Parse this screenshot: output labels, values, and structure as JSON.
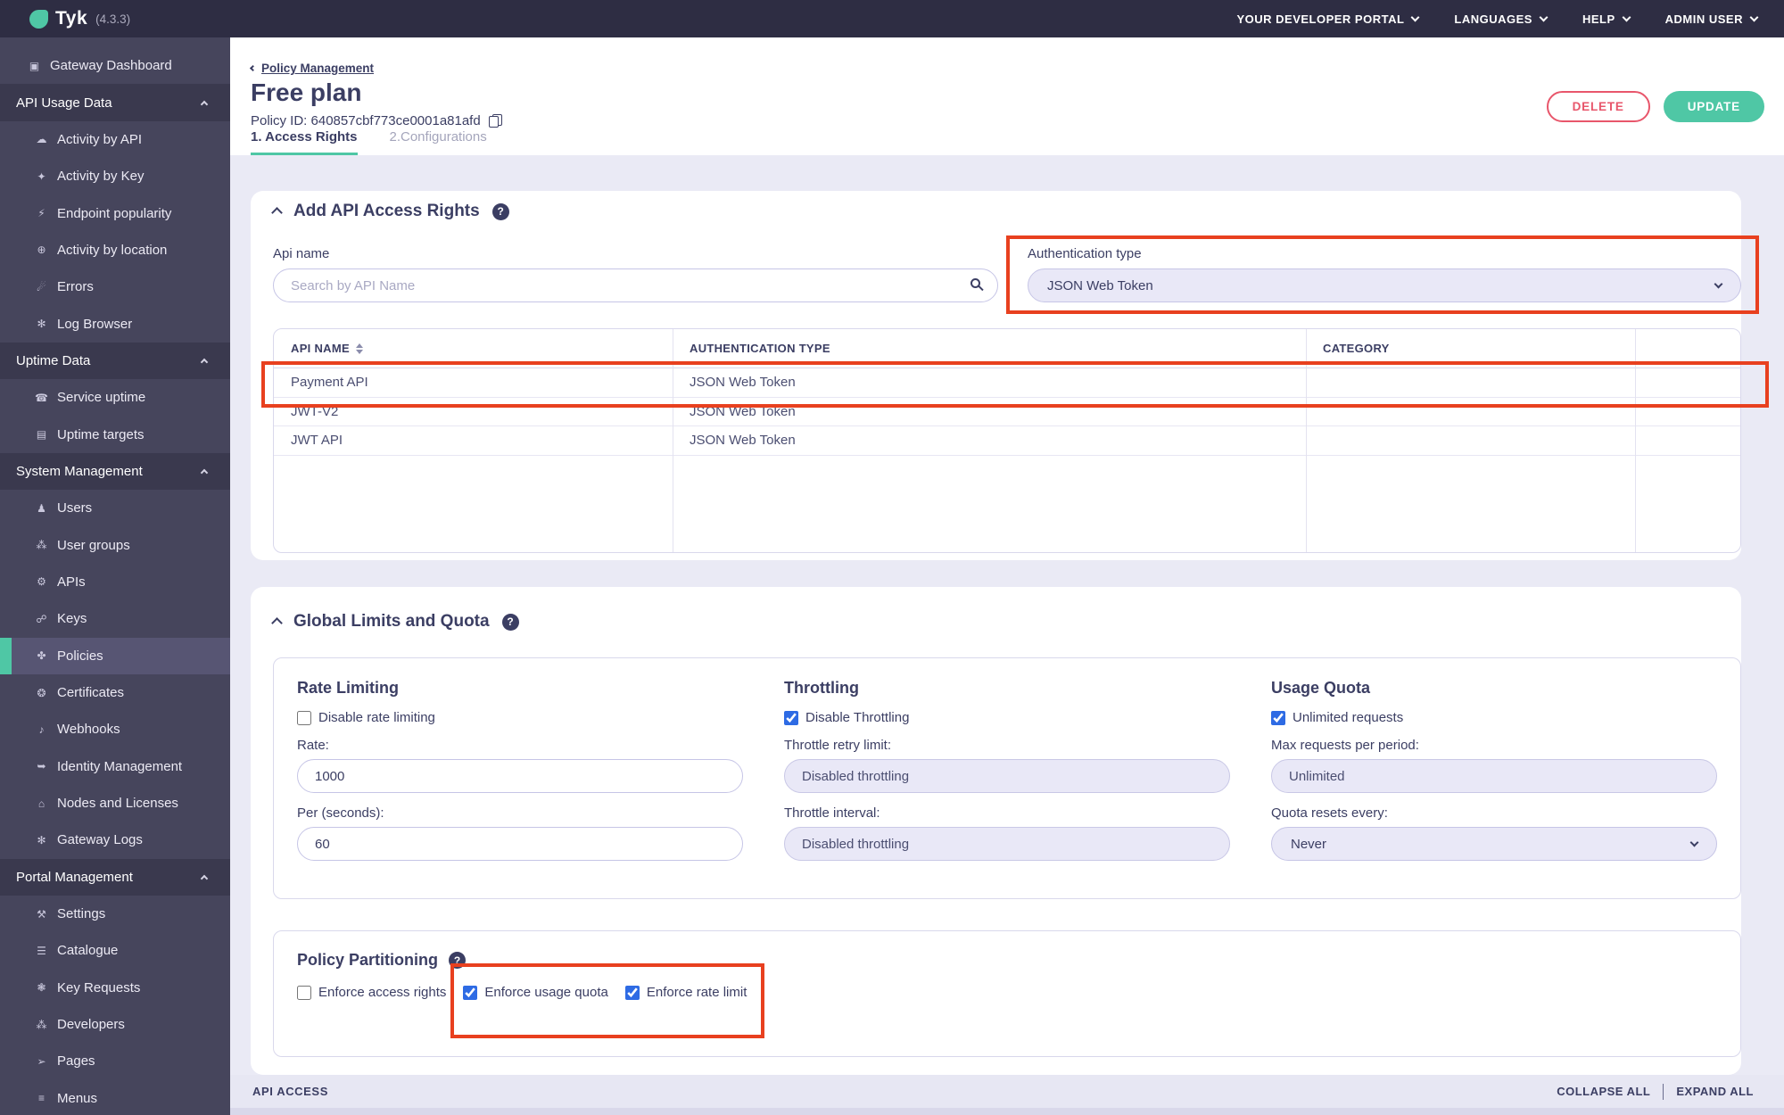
{
  "header": {
    "brand": "Tyk",
    "version": "(4.3.3)",
    "menu": [
      {
        "label": "YOUR DEVELOPER PORTAL"
      },
      {
        "label": "LANGUAGES"
      },
      {
        "label": "HELP"
      },
      {
        "label": "ADMIN USER"
      }
    ]
  },
  "sidebar": {
    "items": [
      {
        "type": "item",
        "top": true,
        "icon": "monitor",
        "glyph": "▣",
        "label": "Gateway Dashboard"
      },
      {
        "type": "section",
        "label": "API Usage Data"
      },
      {
        "type": "item",
        "icon": "cloud",
        "glyph": "☁",
        "label": "Activity by API"
      },
      {
        "type": "item",
        "icon": "key",
        "glyph": "✦",
        "label": "Activity by Key"
      },
      {
        "type": "item",
        "icon": "endpoint",
        "glyph": "⚡",
        "label": "Endpoint popularity"
      },
      {
        "type": "item",
        "icon": "globe",
        "glyph": "⊕",
        "label": "Activity by location"
      },
      {
        "type": "item",
        "icon": "bomb",
        "glyph": "☄",
        "label": "Errors"
      },
      {
        "type": "item",
        "icon": "bug",
        "glyph": "✻",
        "label": "Log Browser"
      },
      {
        "type": "section",
        "label": "Uptime Data"
      },
      {
        "type": "item",
        "icon": "phone",
        "glyph": "☎",
        "label": "Service uptime"
      },
      {
        "type": "item",
        "icon": "list",
        "glyph": "▤",
        "label": "Uptime targets"
      },
      {
        "type": "section",
        "label": "System Management"
      },
      {
        "type": "item",
        "icon": "user",
        "glyph": "♟",
        "label": "Users"
      },
      {
        "type": "item",
        "icon": "user-group",
        "glyph": "⁂",
        "label": "User groups"
      },
      {
        "type": "item",
        "icon": "gear",
        "glyph": "⚙",
        "label": "APIs"
      },
      {
        "type": "item",
        "icon": "network",
        "glyph": "☍",
        "label": "Keys"
      },
      {
        "type": "item",
        "icon": "badge",
        "glyph": "✤",
        "label": "Policies",
        "selected": true
      },
      {
        "type": "item",
        "icon": "certificate",
        "glyph": "❂",
        "label": "Certificates"
      },
      {
        "type": "item",
        "icon": "bell",
        "glyph": "♪",
        "label": "Webhooks"
      },
      {
        "type": "item",
        "icon": "identity",
        "glyph": "➥",
        "label": "Identity Management"
      },
      {
        "type": "item",
        "icon": "bank",
        "glyph": "⌂",
        "label": "Nodes and Licenses"
      },
      {
        "type": "item",
        "icon": "bug",
        "glyph": "✻",
        "label": "Gateway Logs"
      },
      {
        "type": "section",
        "label": "Portal Management"
      },
      {
        "type": "item",
        "icon": "wrench",
        "glyph": "⚒",
        "label": "Settings"
      },
      {
        "type": "item",
        "icon": "catalogue",
        "glyph": "☰",
        "label": "Catalogue"
      },
      {
        "type": "item",
        "icon": "paw",
        "glyph": "❃",
        "label": "Key Requests"
      },
      {
        "type": "item",
        "icon": "developers",
        "glyph": "⁂",
        "label": "Developers"
      },
      {
        "type": "item",
        "icon": "pages",
        "glyph": "➢",
        "label": "Pages"
      },
      {
        "type": "item",
        "icon": "menu",
        "glyph": "≡",
        "label": "Menus"
      }
    ]
  },
  "page": {
    "breadcrumb": "Policy Management",
    "title": "Free plan",
    "policy_id": "Policy ID: 640857cbf773ce0001a81afd",
    "tabs": [
      {
        "label": "1. Access Rights",
        "active": true
      },
      {
        "label": "2.Configurations",
        "active": false
      }
    ],
    "delete_label": "DELETE",
    "update_label": "UPDATE"
  },
  "access_rights": {
    "heading": "Add API Access Rights",
    "api_name_label": "Api name",
    "search_placeholder": "Search by API Name",
    "auth_label": "Authentication type",
    "auth_value": "JSON Web Token",
    "table": {
      "columns": [
        "API NAME",
        "AUTHENTICATION TYPE",
        "CATEGORY"
      ],
      "rows": [
        [
          "Payment API",
          "JSON Web Token",
          ""
        ],
        [
          "JWT-V2",
          "JSON Web Token",
          ""
        ],
        [
          "JWT API",
          "JSON Web Token",
          ""
        ]
      ]
    }
  },
  "limits": {
    "heading": "Global Limits and Quota",
    "rate": {
      "title": "Rate Limiting",
      "checkbox": "Disable rate limiting",
      "checked": false,
      "rate_label": "Rate:",
      "rate_value": "1000",
      "per_label": "Per (seconds):",
      "per_value": "60"
    },
    "throttle": {
      "title": "Throttling",
      "checkbox": "Disable Throttling",
      "checked": true,
      "retry_label": "Throttle retry limit:",
      "retry_value": "Disabled throttling",
      "interval_label": "Throttle interval:",
      "interval_value": "Disabled throttling"
    },
    "quota": {
      "title": "Usage Quota",
      "checkbox": "Unlimited requests",
      "checked": true,
      "max_label": "Max requests per period:",
      "max_value": "Unlimited",
      "resets_label": "Quota resets every:",
      "resets_value": "Never"
    }
  },
  "partitioning": {
    "heading": "Policy Partitioning",
    "checkboxes": [
      {
        "label": "Enforce access rights",
        "checked": false
      },
      {
        "label": "Enforce usage quota",
        "checked": true
      },
      {
        "label": "Enforce rate limit",
        "checked": true
      }
    ]
  },
  "footer": {
    "section_label": "API ACCESS",
    "collapse_label": "COLLAPSE ALL",
    "expand_label": "EXPAND ALL"
  },
  "colors": {
    "teal": "#4fc7a5",
    "navy": "#3b3e63",
    "delete_red": "#e8566b",
    "annotation_red": "#e8401f",
    "checkbox_blue": "#2e6be4"
  }
}
